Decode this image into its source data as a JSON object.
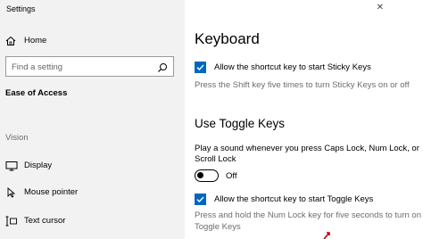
{
  "window": {
    "title": "Settings",
    "close_glyph": "✕"
  },
  "sidebar": {
    "home_label": "Home",
    "search_placeholder": "Find a setting",
    "section_header": "Ease of Access",
    "group_label": "Vision",
    "items": [
      {
        "label": "Display",
        "icon": "display-icon"
      },
      {
        "label": "Mouse pointer",
        "icon": "mouse-pointer-icon"
      },
      {
        "label": "Text cursor",
        "icon": "text-cursor-icon"
      }
    ]
  },
  "main": {
    "title": "Keyboard",
    "sticky_keys": {
      "checkbox_label": "Allow the shortcut key to start Sticky Keys",
      "checked": true,
      "description": "Press the Shift key five times to turn Sticky Keys on or off"
    },
    "toggle_keys": {
      "heading": "Use Toggle Keys",
      "sound_text_line1": "Play a sound whenever you press Caps Lock, Num Lock, or",
      "sound_text_line2": "Scroll Lock",
      "toggle_state": "Off",
      "checkbox_label": "Allow the shortcut key to start Toggle Keys",
      "checked": true,
      "description_line1": "Press and hold the Num Lock key for five seconds to turn on",
      "description_line2": "Toggle Keys"
    }
  },
  "colors": {
    "accent": "#0067c0",
    "sidebar_bg": "#f2f2f2",
    "muted_text": "#6d6d6d"
  }
}
